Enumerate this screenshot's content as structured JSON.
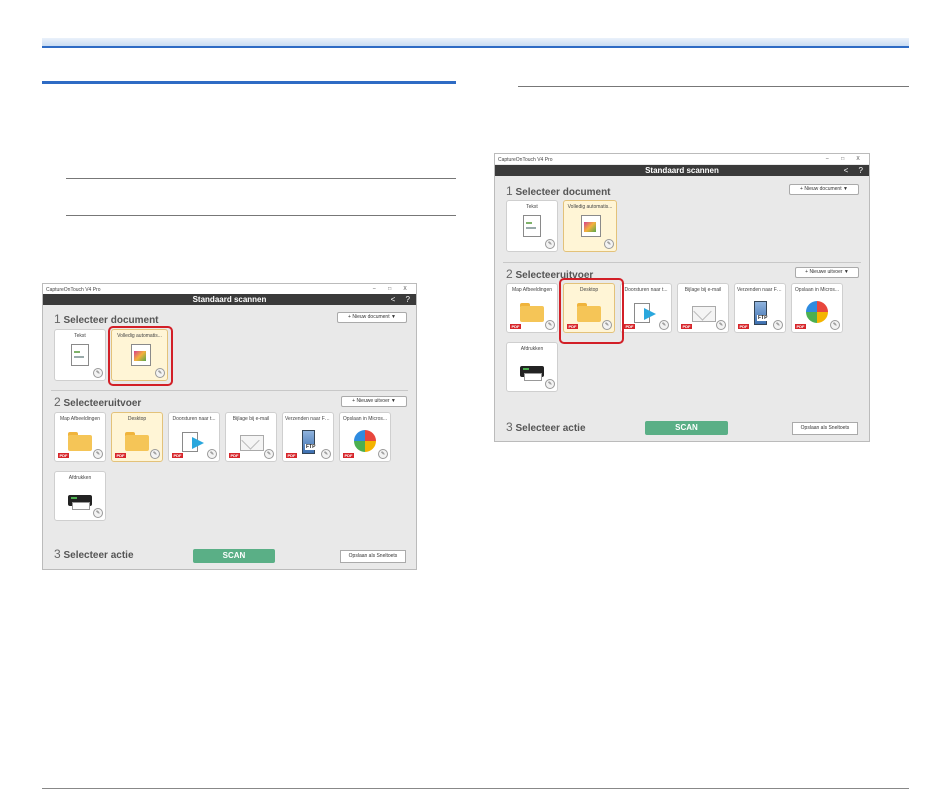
{
  "window": {
    "app_title": "CaptureOnTouch V4 Pro",
    "controls": [
      "–",
      "□",
      "X"
    ],
    "header_title": "Standaard scannen",
    "nav_back": "<",
    "help": "?"
  },
  "sections": {
    "doc": {
      "num": "1",
      "title": "Selecteer document",
      "new_button": "+ Nieuw document ▼"
    },
    "out": {
      "num": "2",
      "title": "Selecteeruitvoer",
      "new_button": "+ Nieuwe uitvoer ▼"
    },
    "act": {
      "num": "3",
      "title": "Selecteer actie",
      "scan_button": "SCAN",
      "save_button": "Opslaan als Sneltoets"
    }
  },
  "documents": [
    {
      "label": "Tekst",
      "icon": "text-document-icon"
    },
    {
      "label": "Volledig automatis...",
      "icon": "photo-document-icon"
    }
  ],
  "outputs": [
    {
      "label": "Map Afbeeldingen",
      "icon": "folder-icon",
      "badge": "PDF"
    },
    {
      "label": "Desktop",
      "icon": "folder-icon",
      "badge": "PDF"
    },
    {
      "label": "Doorsturen naar t...",
      "icon": "forward-icon",
      "badge": "PDF"
    },
    {
      "label": "Bijlage bij e-mail",
      "icon": "mail-icon",
      "badge": "PDF"
    },
    {
      "label": "Verzenden naar FT...",
      "icon": "ftp-server-icon",
      "badge": "PDF",
      "sub": "FTP"
    },
    {
      "label": "Opslaan in Micros...",
      "icon": "microsoft-app-icon",
      "badge": "PDF"
    },
    {
      "label": "Afdrukken",
      "icon": "printer-icon"
    }
  ]
}
